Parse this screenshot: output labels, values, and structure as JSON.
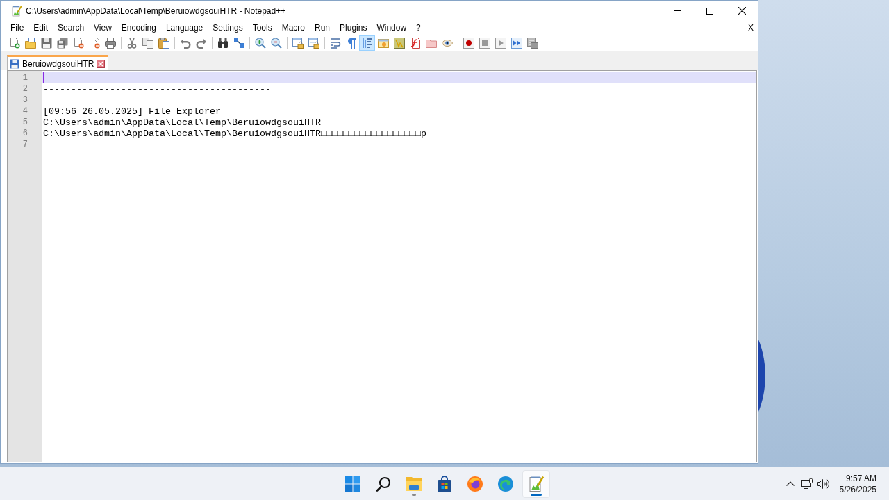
{
  "window": {
    "title": "C:\\Users\\admin\\AppData\\Local\\Temp\\BeruiowdgsouiHTR - Notepad++"
  },
  "menu": {
    "items": [
      "File",
      "Edit",
      "Search",
      "View",
      "Encoding",
      "Language",
      "Settings",
      "Tools",
      "Macro",
      "Run",
      "Plugins",
      "Window",
      "?"
    ],
    "close_label": "X"
  },
  "toolbar": {
    "groups": [
      {
        "buttons": [
          {
            "selected": false
          },
          {
            "selected": false
          },
          {
            "selected": false
          },
          {
            "selected": false
          },
          {
            "selected": false
          },
          {
            "selected": false
          },
          {
            "selected": false
          }
        ]
      },
      {
        "buttons": [
          {
            "selected": false
          },
          {
            "selected": false
          },
          {
            "selected": false
          }
        ]
      },
      {
        "buttons": [
          {
            "selected": false
          },
          {
            "selected": false
          }
        ]
      },
      {
        "buttons": [
          {
            "selected": false
          },
          {
            "selected": false
          }
        ]
      },
      {
        "buttons": [
          {
            "selected": false
          },
          {
            "selected": false
          }
        ]
      },
      {
        "buttons": [
          {
            "selected": false
          },
          {
            "selected": false
          }
        ]
      },
      {
        "buttons": [
          {
            "selected": false
          },
          {
            "selected": false
          },
          {
            "selected": true
          },
          {
            "selected": false
          },
          {
            "selected": false
          },
          {
            "selected": false
          },
          {
            "selected": false
          },
          {
            "selected": false
          }
        ]
      },
      {
        "buttons": [
          {
            "selected": false
          },
          {
            "selected": false
          },
          {
            "selected": false
          },
          {
            "selected": false
          },
          {
            "selected": false
          }
        ]
      }
    ]
  },
  "tabs": [
    {
      "label": "BeruiowdgsouiHTR",
      "selected": true,
      "modified": false
    }
  ],
  "editor": {
    "lines": [
      {
        "number": "1",
        "current": true
      },
      {
        "number": "2",
        "text": "-----------------------------------------",
        "current": false
      },
      {
        "number": "3",
        "current": false
      },
      {
        "number": "4",
        "text": "[09:56 26.05.2025] File Explorer",
        "current": false
      },
      {
        "number": "5",
        "text": "C:\\Users\\admin\\AppData\\Local\\Temp\\BeruiowdgsouiHTR",
        "current": false
      },
      {
        "number": "6",
        "text": "C:\\Users\\admin\\AppData\\Local\\Temp\\BeruiowdgsouiHTR□□□□□□□□□□□□□□□□□□p",
        "current": false
      },
      {
        "number": "7",
        "current": false
      }
    ]
  },
  "taskbar": {
    "apps": [
      {
        "running": false,
        "active": false
      },
      {
        "running": false,
        "active": false
      },
      {
        "running": true,
        "active": false
      },
      {
        "running": false,
        "active": false
      },
      {
        "running": false,
        "active": false
      },
      {
        "running": false,
        "active": false
      },
      {
        "running": true,
        "active": true
      }
    ]
  },
  "tray": {
    "time": "9:57 AM",
    "date": "5/26/2025"
  }
}
